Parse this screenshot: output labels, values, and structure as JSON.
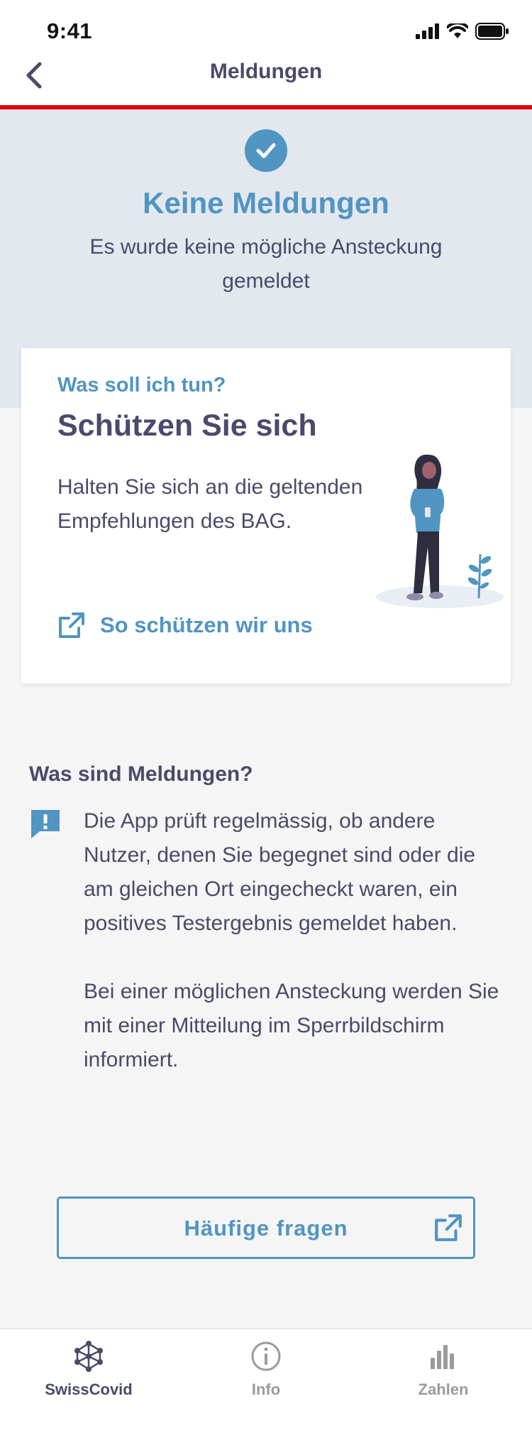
{
  "status_bar": {
    "time": "9:41"
  },
  "nav": {
    "title": "Meldungen"
  },
  "header": {
    "title": "Keine Meldungen",
    "subtitle": "Es wurde keine mögliche Ansteckung gemeldet"
  },
  "card": {
    "eyebrow": "Was soll ich tun?",
    "title": "Schützen Sie sich",
    "text": "Halten Sie sich an die geltenden Empfehlungen des BAG.",
    "link_label": "So schützen wir uns"
  },
  "info": {
    "heading": "Was sind Meldungen?",
    "paragraph1": "Die App prüft regelmässig, ob andere Nutzer, denen Sie begegnet sind oder die am gleichen Ort eingecheckt waren, ein positives Testergebnis gemeldet haben.",
    "paragraph2": "Bei einer möglichen Ansteckung werden Sie mit einer Mitteilung im Sperrbildschirm informiert."
  },
  "faq_button": {
    "label": "Häufige fragen"
  },
  "tabs": [
    {
      "label": "SwissCovid",
      "icon": "swisscovid-icon",
      "active": true
    },
    {
      "label": "Info",
      "icon": "info-icon",
      "active": false
    },
    {
      "label": "Zahlen",
      "icon": "bar-chart-icon",
      "active": false
    }
  ],
  "colors": {
    "accent": "#5195c2",
    "text_dark": "#4a4a6a",
    "nav_line_red": "#e20008",
    "header_bg": "#e3e8ef",
    "page_bg": "#f5f5f5",
    "tab_active": "#4a4a6a",
    "tab_inactive": "#9b9b9b"
  }
}
